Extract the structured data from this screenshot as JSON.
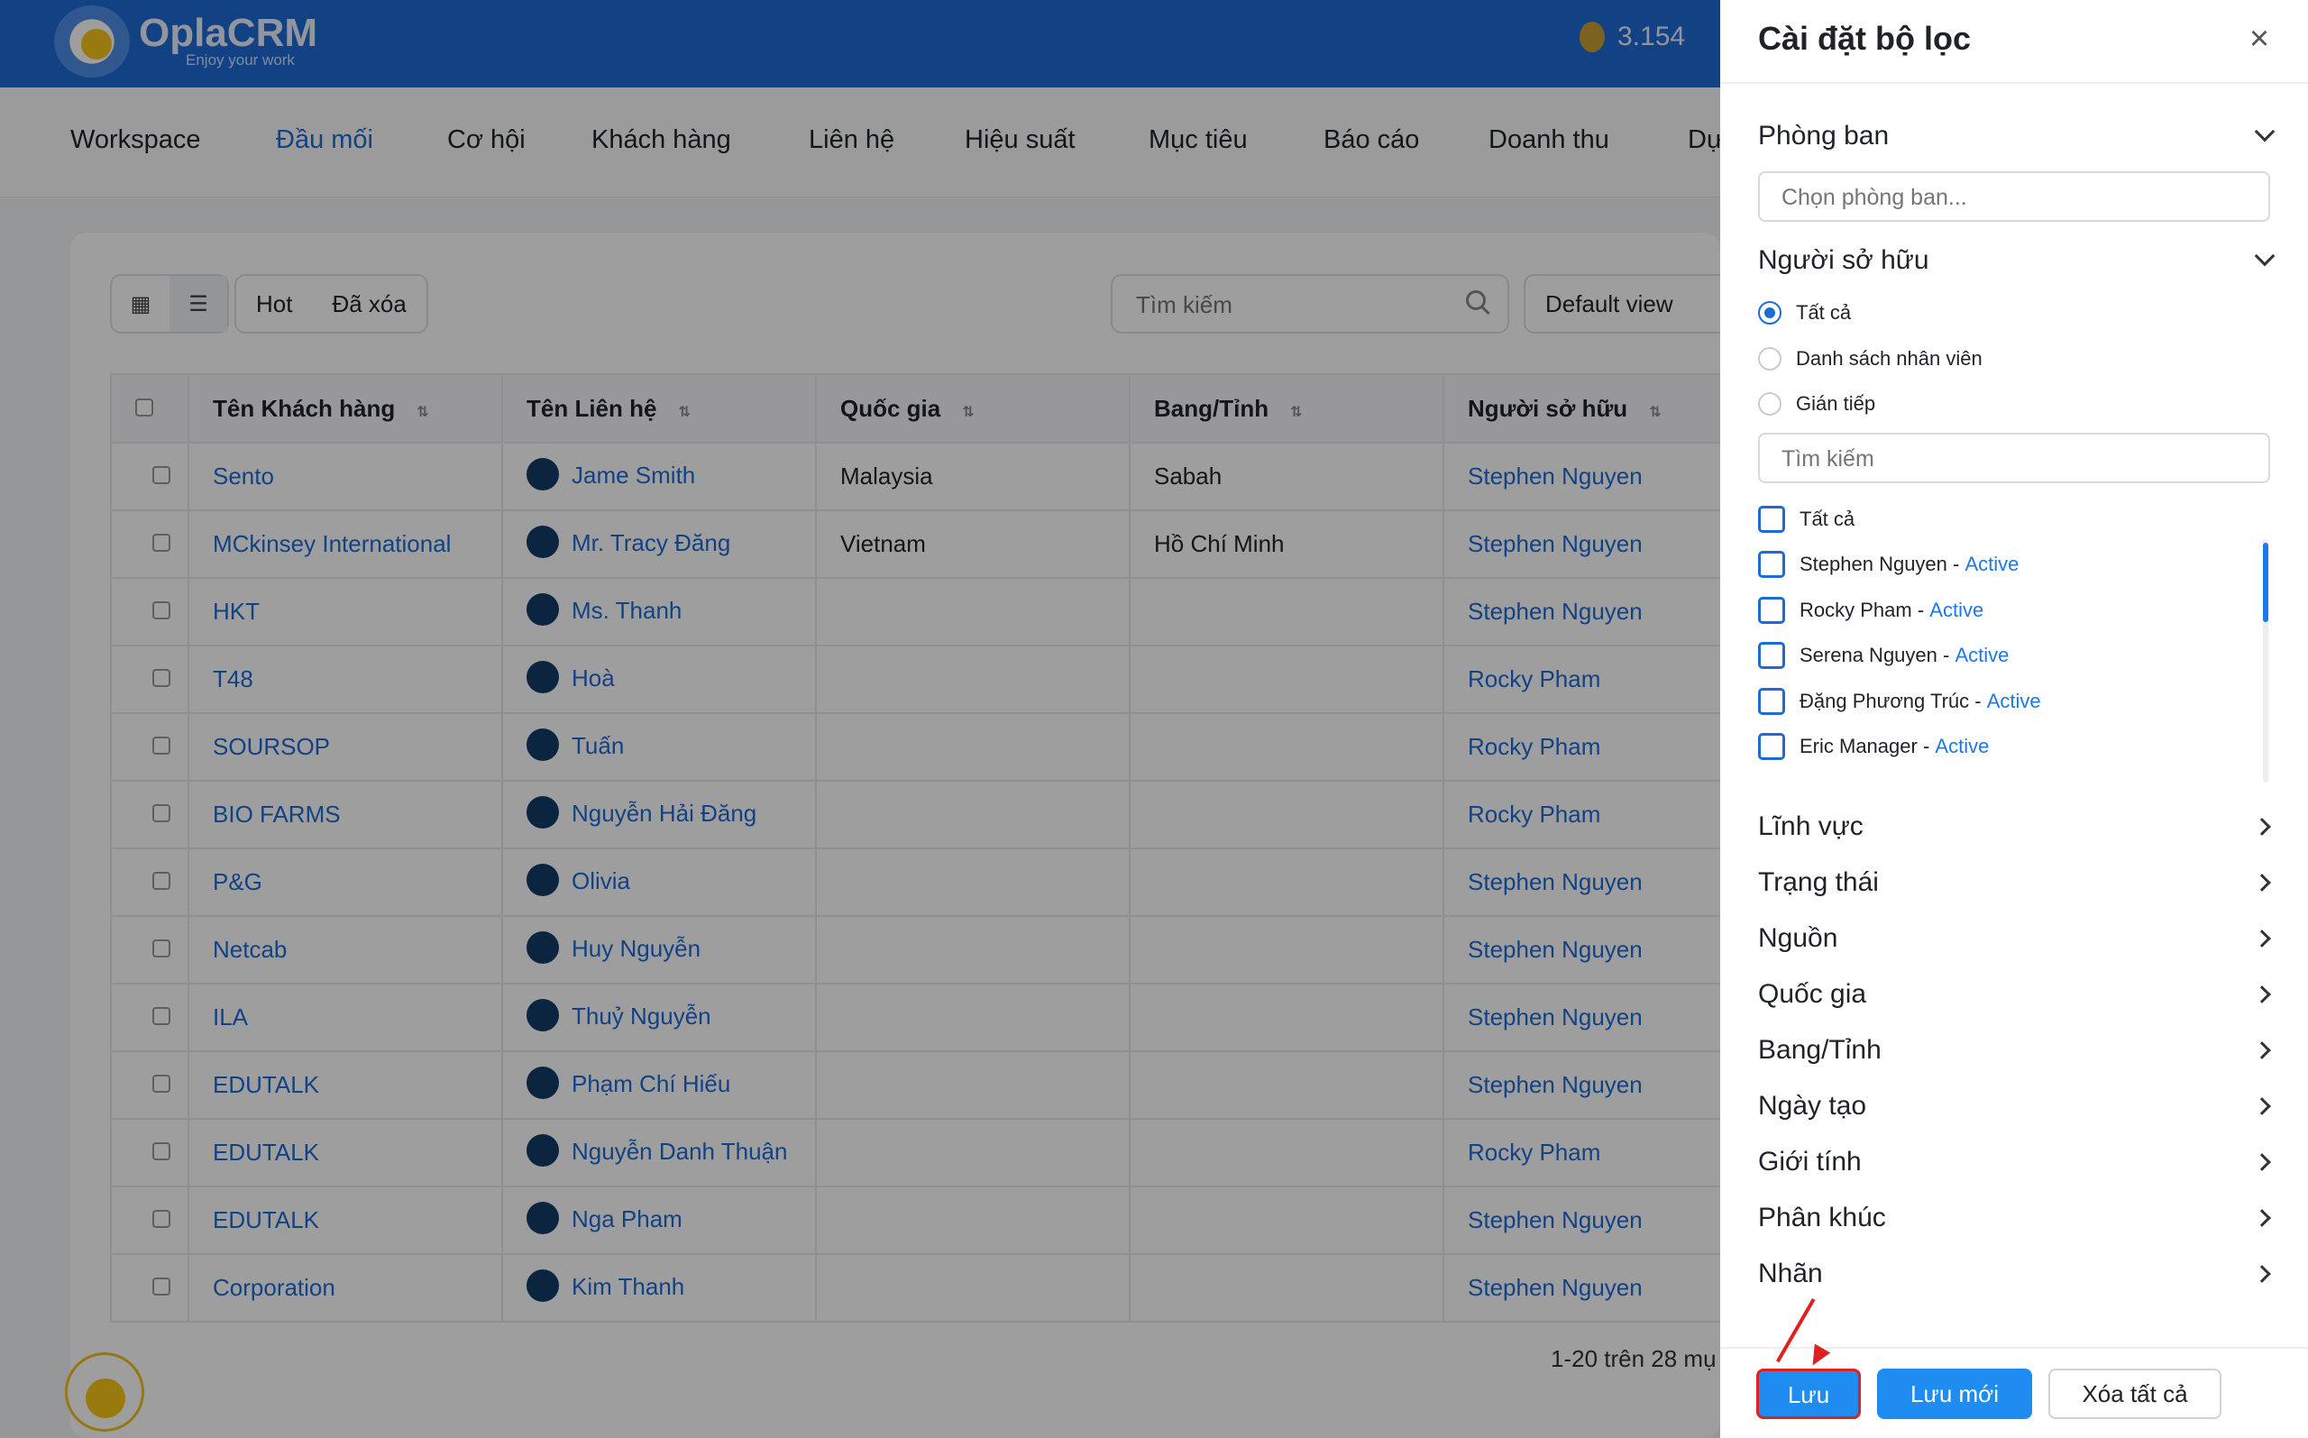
{
  "app": {
    "name": "OplaCRM",
    "tagline": "Enjoy your work",
    "coins": "3.154"
  },
  "nav": {
    "items": [
      "Workspace",
      "Đầu mối",
      "Cơ hội",
      "Khách hàng",
      "Liên hệ",
      "Hiệu suất",
      "Mục tiêu",
      "Báo cáo",
      "Doanh thu",
      "Dự"
    ],
    "active": "Đầu mối"
  },
  "toolbar": {
    "tabs": [
      "Hot",
      "Đã xóa"
    ],
    "search_placeholder": "Tìm kiếm",
    "view_select": "Default view"
  },
  "table": {
    "headers": [
      "Tên Khách hàng",
      "Tên Liên hệ",
      "Quốc gia",
      "Bang/Tỉnh",
      "Người sở hữu"
    ],
    "rows": [
      [
        "Sento",
        "Jame Smith",
        "Malaysia",
        "Sabah",
        "Stephen Nguyen"
      ],
      [
        "MCkinsey International",
        "Mr. Tracy Đăng",
        "Vietnam",
        "Hồ Chí Minh",
        "Stephen Nguyen"
      ],
      [
        "HKT",
        "Ms. Thanh",
        "",
        "",
        "Stephen Nguyen"
      ],
      [
        "T48",
        "Hoà",
        "",
        "",
        "Rocky Pham"
      ],
      [
        "SOURSOP",
        "Tuấn",
        "",
        "",
        "Rocky Pham"
      ],
      [
        "BIO FARMS",
        "Nguyễn Hải Đăng",
        "",
        "",
        "Rocky Pham"
      ],
      [
        "P&G",
        "Olivia",
        "",
        "",
        "Stephen Nguyen"
      ],
      [
        "Netcab",
        "Huy Nguyễn",
        "",
        "",
        "Stephen Nguyen"
      ],
      [
        "ILA",
        "Thuỷ Nguyễn",
        "",
        "",
        "Stephen Nguyen"
      ],
      [
        "EDUTALK",
        "Phạm Chí Hiếu",
        "",
        "",
        "Stephen Nguyen"
      ],
      [
        "EDUTALK",
        "Nguyễn Danh Thuận",
        "",
        "",
        "Rocky Pham"
      ],
      [
        "EDUTALK",
        "Nga Pham",
        "",
        "",
        "Stephen Nguyen"
      ],
      [
        "Corporation",
        "Kim Thanh",
        "",
        "",
        "Stephen Nguyen"
      ]
    ],
    "pagination": "1-20 trên 28 mụ"
  },
  "drawer": {
    "title": "Cài đặt bộ lọc",
    "department": {
      "label": "Phòng ban",
      "placeholder": "Chọn phòng ban..."
    },
    "owner": {
      "label": "Người sở hữu",
      "radios": [
        "Tất cả",
        "Danh sách nhân viên",
        "Gián tiếp"
      ],
      "radio_selected": "Tất cả",
      "search_placeholder": "Tìm kiếm",
      "check_all": "Tất cả",
      "people": [
        {
          "name": "Stephen Nguyen",
          "status": "Active"
        },
        {
          "name": "Rocky Pham",
          "status": "Active"
        },
        {
          "name": "Serena Nguyen",
          "status": "Active"
        },
        {
          "name": "Đặng Phương Trúc",
          "status": "Active"
        },
        {
          "name": "Eric Manager",
          "status": "Active"
        }
      ]
    },
    "sections": [
      "Lĩnh vực",
      "Trạng thái",
      "Nguồn",
      "Quốc gia",
      "Bang/Tỉnh",
      "Ngày tạo",
      "Giới tính",
      "Phân khúc",
      "Nhãn"
    ],
    "buttons": {
      "save": "Lưu",
      "save_new": "Lưu mới",
      "clear_all": "Xóa tất cả"
    }
  },
  "colors": {
    "brand": "#1e6bd6",
    "accent": "#1e8cf0",
    "highlight": "#e02020"
  }
}
